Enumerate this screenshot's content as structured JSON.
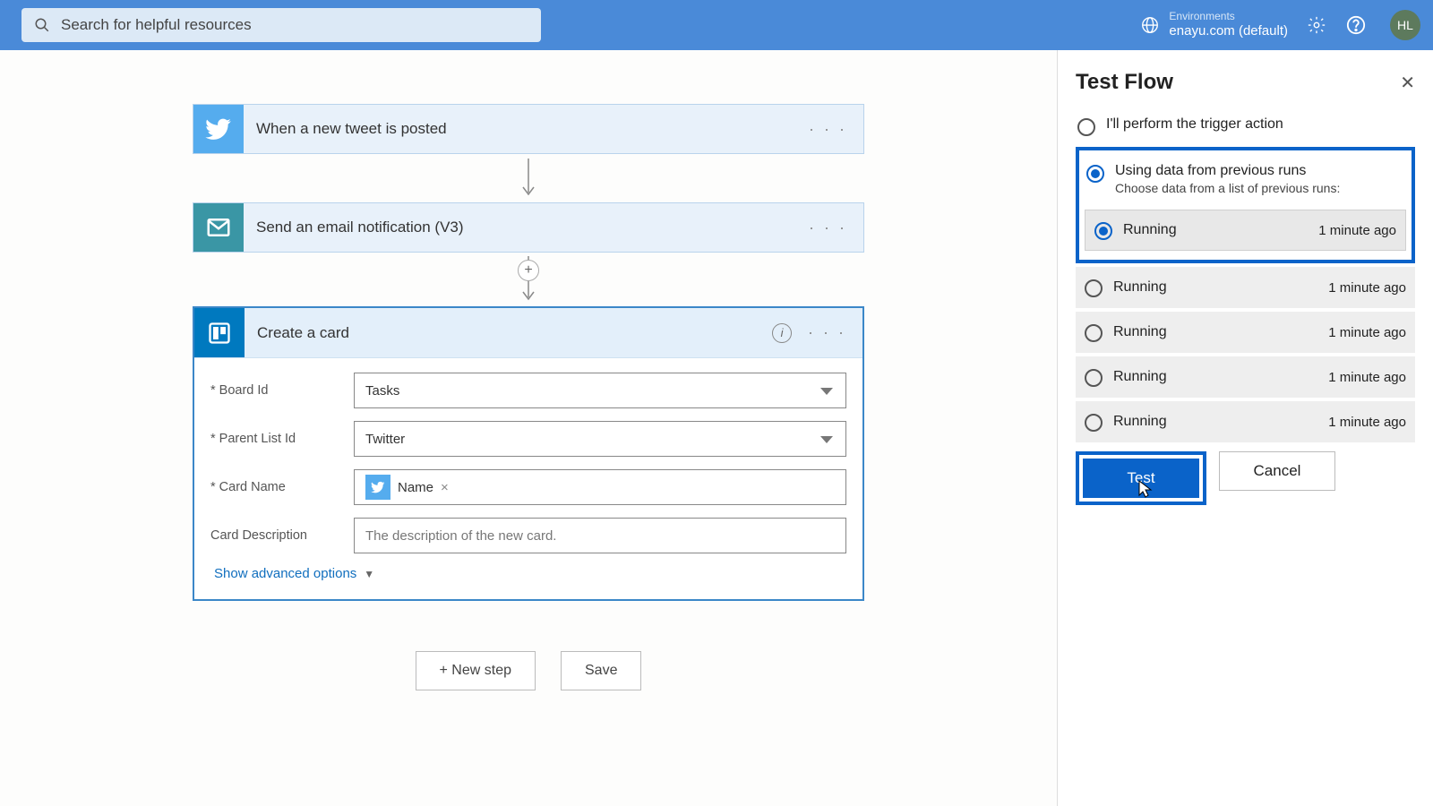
{
  "header": {
    "search_placeholder": "Search for helpful resources",
    "env_label": "Environments",
    "env_name": "enayu.com (default)",
    "avatar_initials": "HL"
  },
  "flow": {
    "steps": [
      {
        "title": "When a new tweet is posted"
      },
      {
        "title": "Send an email notification (V3)"
      }
    ],
    "expanded": {
      "title": "Create a card",
      "fields": {
        "board_label": "* Board Id",
        "board_value": "Tasks",
        "parent_label": "* Parent List Id",
        "parent_value": "Twitter",
        "cardname_label": "* Card Name",
        "cardname_token": "Name",
        "desc_label": "Card Description",
        "desc_placeholder": "The description of the new card."
      },
      "advanced_link": "Show advanced options"
    },
    "buttons": {
      "new_step": "+ New step",
      "save": "Save"
    }
  },
  "panel": {
    "title": "Test Flow",
    "option_manual": "I'll perform the trigger action",
    "option_previous": "Using data from previous runs",
    "option_previous_sub": "Choose data from a list of previous runs:",
    "runs": [
      {
        "status": "Running",
        "time": "1 minute ago",
        "selected": true
      },
      {
        "status": "Running",
        "time": "1 minute ago",
        "selected": false
      },
      {
        "status": "Running",
        "time": "1 minute ago",
        "selected": false
      },
      {
        "status": "Running",
        "time": "1 minute ago",
        "selected": false
      },
      {
        "status": "Running",
        "time": "1 minute ago",
        "selected": false
      }
    ],
    "test_btn": "Test",
    "cancel_btn": "Cancel"
  }
}
